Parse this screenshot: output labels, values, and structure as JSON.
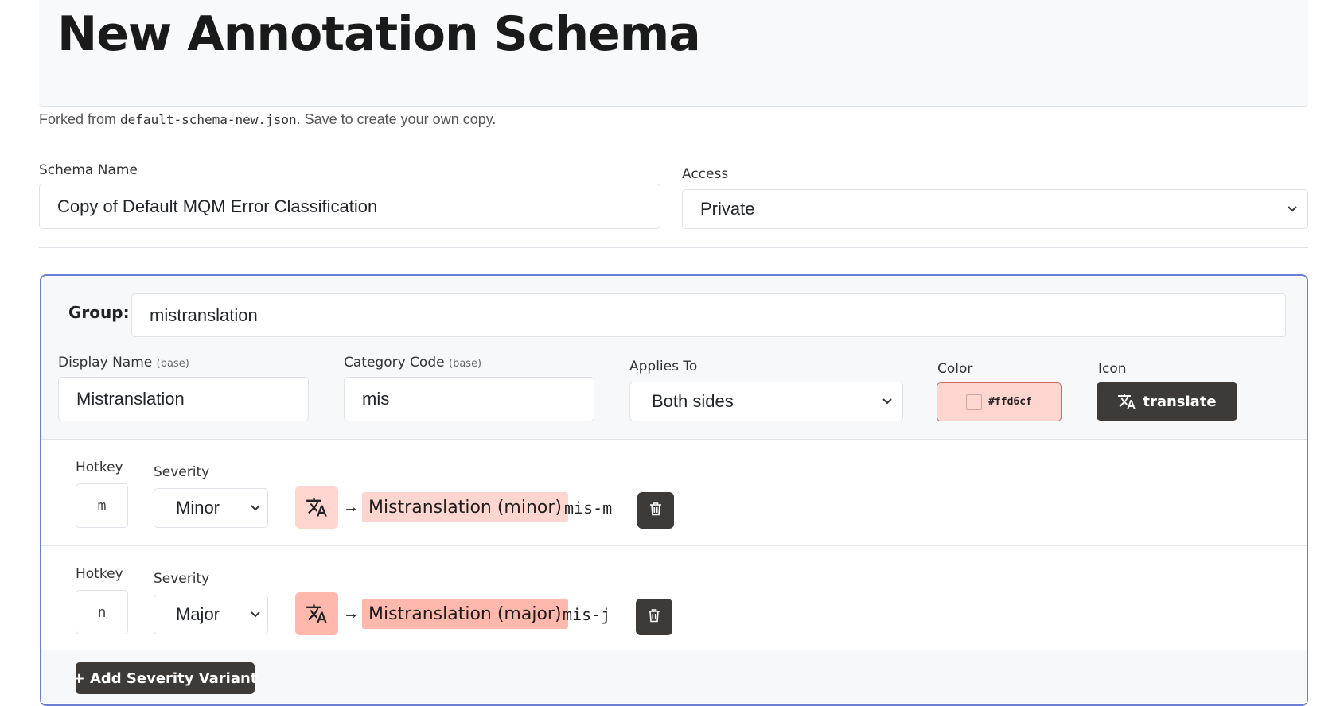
{
  "header": {
    "title": "New Annotation Schema",
    "forked_prefix": "Forked from ",
    "forked_file": "default-schema-new.json",
    "forked_suffix": ". Save to create your own copy."
  },
  "schema": {
    "name_label": "Schema Name",
    "name_value": "Copy of Default MQM Error Classification",
    "access_label": "Access",
    "access_value": "Private"
  },
  "group": {
    "label": "Group:",
    "name_value": "mistranslation",
    "display_name_label": "Display Name",
    "display_name_hint": "(base)",
    "display_name_value": "Mistranslation",
    "category_code_label": "Category Code",
    "category_code_hint": "(base)",
    "category_code_value": "mis",
    "applies_to_label": "Applies To",
    "applies_to_value": "Both sides",
    "color_label": "Color",
    "color_value": "#ffd6cf",
    "icon_label": "Icon",
    "icon_value": "translate",
    "icon_name": "translate-icon"
  },
  "variants": [
    {
      "hotkey_label": "Hotkey",
      "hotkey": "m",
      "severity_label": "Severity",
      "severity": "Minor",
      "preview_label": "Mistranslation (minor)",
      "preview_color": "#ffd6cf",
      "code": "mis-m"
    },
    {
      "hotkey_label": "Hotkey",
      "hotkey": "n",
      "severity_label": "Severity",
      "severity": "Major",
      "preview_label": "Mistranslation (major)",
      "preview_color": "#ffb8ab",
      "code": "mis-j"
    }
  ],
  "arrow": "→",
  "add_variant_label": "+ Add Severity Variant",
  "chevron": "⌄"
}
